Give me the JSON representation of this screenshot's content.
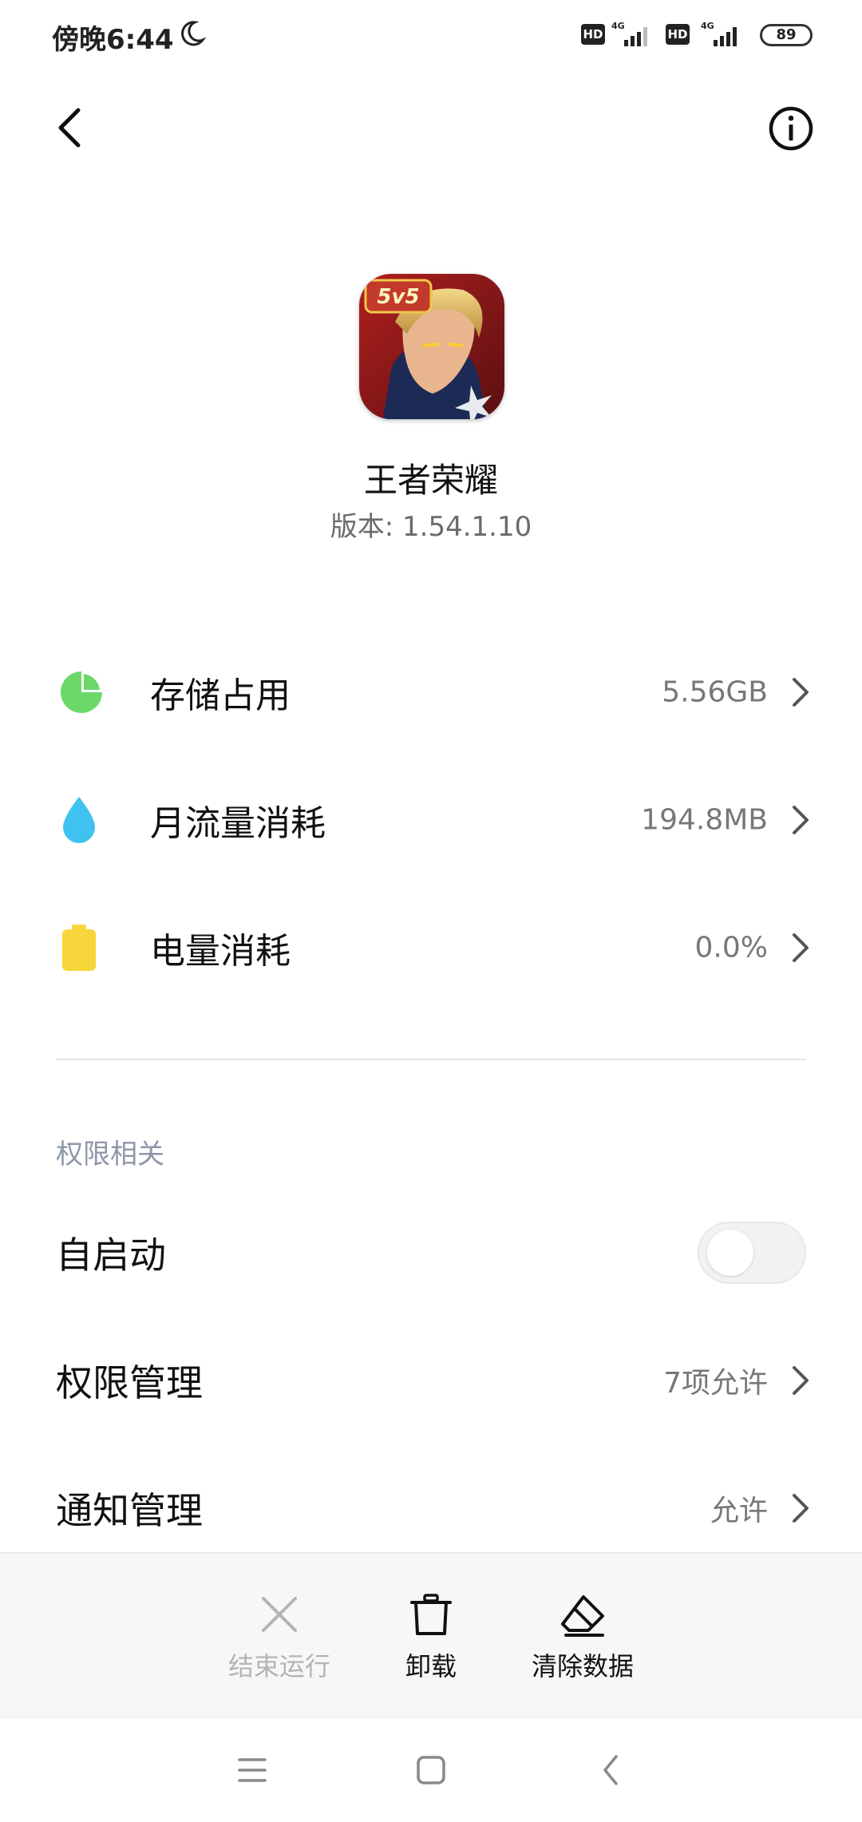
{
  "status_bar": {
    "time": "傍晚6:44",
    "hd_label": "HD",
    "network": "4G",
    "battery": "89"
  },
  "app": {
    "name": "王者荣耀",
    "version": "版本: 1.54.1.10",
    "icon_text": "5v5"
  },
  "usage": [
    {
      "label": "存储占用",
      "value": "5.56GB",
      "icon": "storage-pie-icon",
      "color": "#6cd86a"
    },
    {
      "label": "月流量消耗",
      "value": "194.8MB",
      "icon": "data-drop-icon",
      "color": "#3fc2f0"
    },
    {
      "label": "电量消耗",
      "value": "0.0%",
      "icon": "battery-icon",
      "color": "#f7d63b"
    }
  ],
  "permissions": {
    "section_title": "权限相关",
    "autostart_label": "自启动",
    "autostart_on": false,
    "manage_label": "权限管理",
    "manage_value": "7项允许",
    "notify_label": "通知管理",
    "notify_value": "允许"
  },
  "actions": {
    "stop_label": "结束运行",
    "uninstall_label": "卸载",
    "clear_label": "清除数据"
  },
  "colors": {
    "accent_section": "#8e96a8",
    "disabled_text": "#b4b4b4"
  }
}
